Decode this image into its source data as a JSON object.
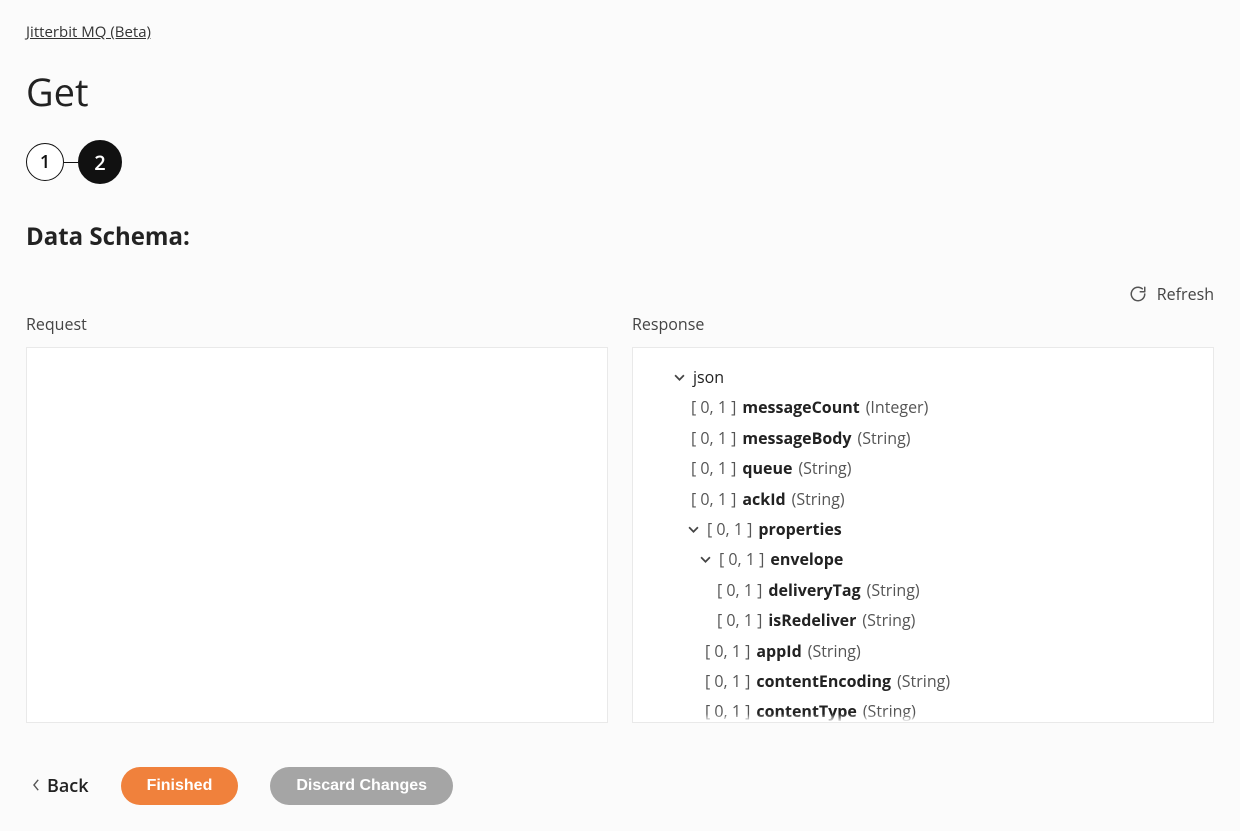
{
  "breadcrumb": {
    "label": "Jitterbit MQ (Beta)"
  },
  "title": "Get",
  "stepper": {
    "steps": [
      "1",
      "2"
    ],
    "active_index": 1
  },
  "section_title": "Data Schema:",
  "refresh": {
    "label": "Refresh"
  },
  "request": {
    "header": "Request"
  },
  "response": {
    "header": "Response",
    "tree": {
      "root": "json",
      "nodes": [
        {
          "card": "[ 0, 1 ]",
          "name": "messageCount",
          "type": "(Integer)",
          "indent": "ind-1"
        },
        {
          "card": "[ 0, 1 ]",
          "name": "messageBody",
          "type": "(String)",
          "indent": "ind-1"
        },
        {
          "card": "[ 0, 1 ]",
          "name": "queue",
          "type": "(String)",
          "indent": "ind-1"
        },
        {
          "card": "[ 0, 1 ]",
          "name": "ackId",
          "type": "(String)",
          "indent": "ind-1"
        },
        {
          "card": "[ 0, 1 ]",
          "name": "properties",
          "type": "",
          "indent": "ind-1b",
          "chevron": true
        },
        {
          "card": "[ 0, 1 ]",
          "name": "envelope",
          "type": "",
          "indent": "ind-2",
          "chevron": true
        },
        {
          "card": "[ 0, 1 ]",
          "name": "deliveryTag",
          "type": "(String)",
          "indent": "ind-3"
        },
        {
          "card": "[ 0, 1 ]",
          "name": "isRedeliver",
          "type": "(String)",
          "indent": "ind-3"
        },
        {
          "card": "[ 0, 1 ]",
          "name": "appId",
          "type": "(String)",
          "indent": "ind-2b"
        },
        {
          "card": "[ 0, 1 ]",
          "name": "contentEncoding",
          "type": "(String)",
          "indent": "ind-2b"
        },
        {
          "card": "[ 0, 1 ]",
          "name": "contentType",
          "type": "(String)",
          "indent": "ind-2b"
        }
      ]
    }
  },
  "footer": {
    "back": "Back",
    "finished": "Finished",
    "discard": "Discard Changes"
  }
}
